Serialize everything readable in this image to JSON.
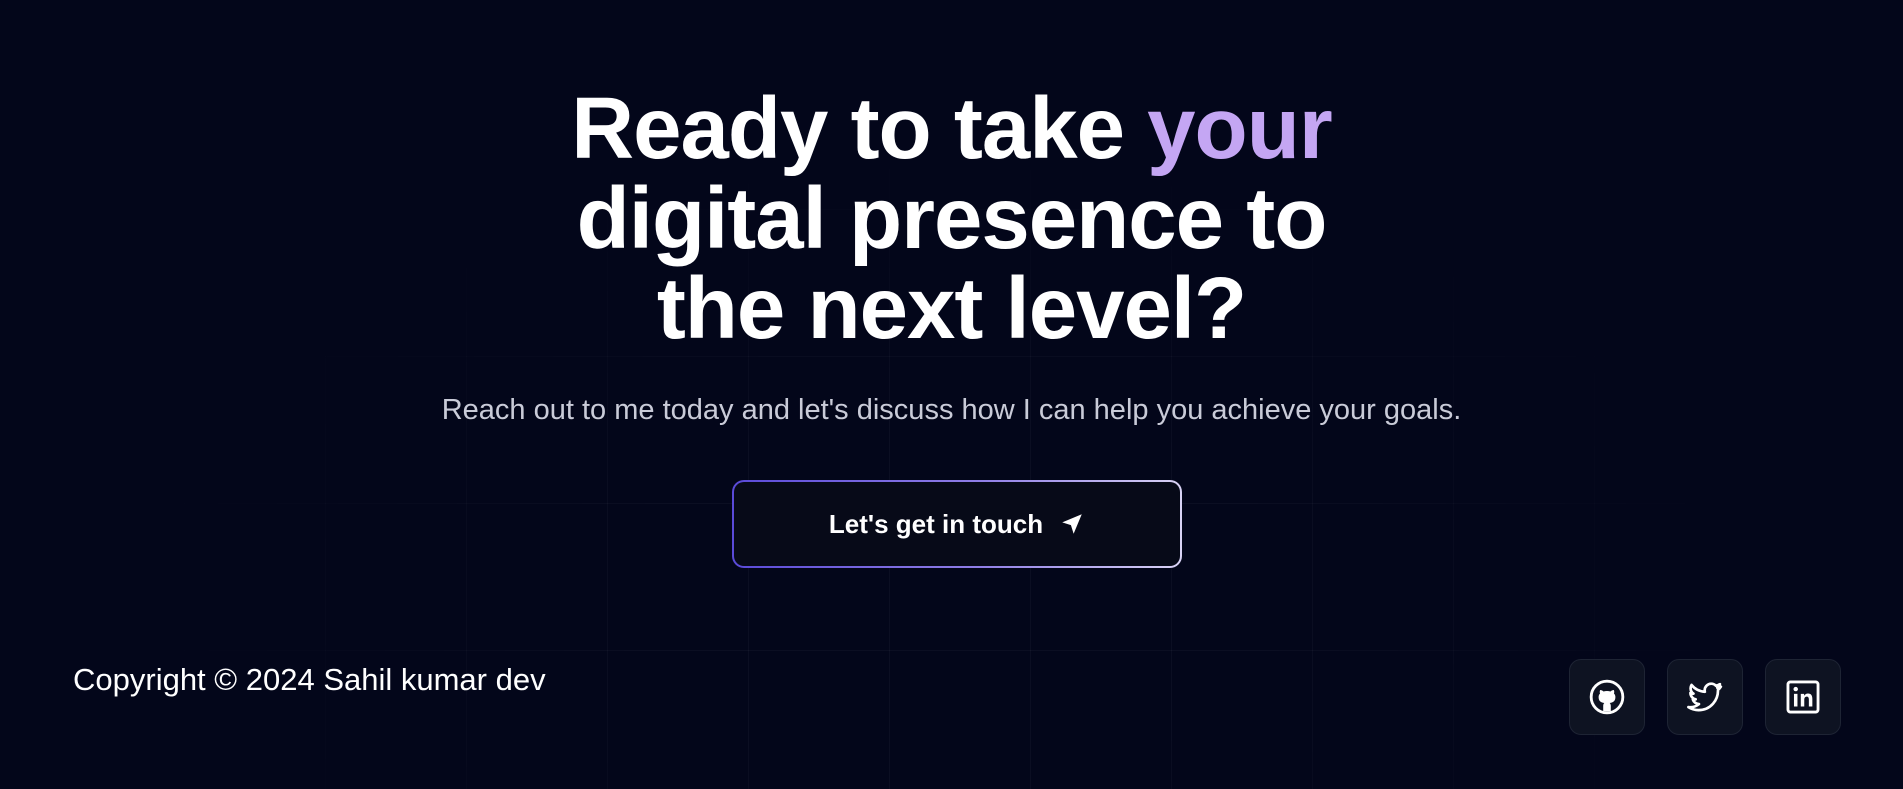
{
  "hero": {
    "headline_before": "Ready to take ",
    "headline_accent": "your",
    "headline_line2": "digital presence to",
    "headline_line3": "the next level?",
    "subline": "Reach out to me today and let's discuss how I can help you achieve your goals.",
    "cta_label": "Let's get in touch",
    "cta_icon": "send-icon"
  },
  "footer": {
    "copyright": "Copyright © 2024 Sahil kumar dev",
    "socials": [
      {
        "icon": "github-icon"
      },
      {
        "icon": "twitter-icon"
      },
      {
        "icon": "linkedin-icon"
      }
    ]
  },
  "colors": {
    "background": "#03061a",
    "accent": "#c4a6f3",
    "text": "#ffffff",
    "subtext": "#c9cbd8",
    "button_border_start": "#5a4ad8",
    "button_border_end": "#d9d3f5"
  }
}
